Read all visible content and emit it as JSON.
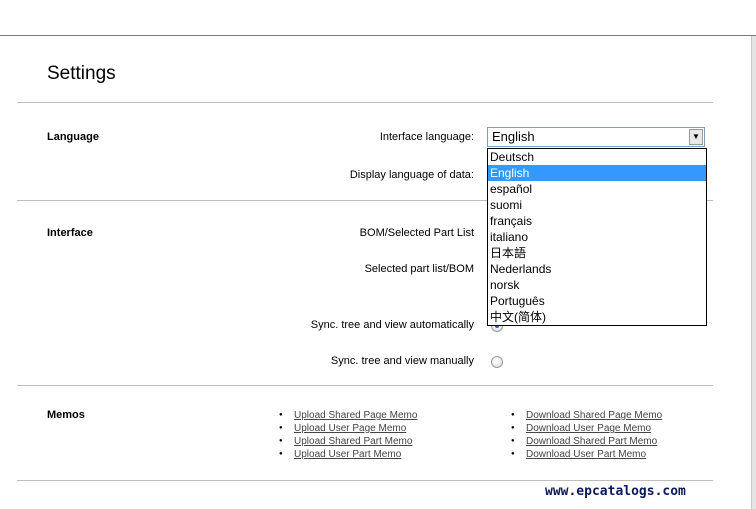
{
  "page": {
    "title": "Settings"
  },
  "language": {
    "heading": "Language",
    "interface_label": "Interface language:",
    "selected": "English",
    "display_label": "Display language of data:",
    "options": [
      "Deutsch",
      "English",
      "español",
      "suomi",
      "français",
      "italiano",
      "日本語",
      "Nederlands",
      "norsk",
      "Português",
      "中文(简体)"
    ],
    "selected_index": 1
  },
  "interface": {
    "heading": "Interface",
    "bom_label": "BOM/Selected Part List",
    "part_label": "Selected part list/BOM",
    "sync_auto_label": "Sync. tree and view automatically",
    "sync_manual_label": "Sync. tree and view manually"
  },
  "memos": {
    "heading": "Memos",
    "upload": [
      "Upload Shared Page Memo",
      "Upload User Page Memo",
      "Upload Shared Part Memo",
      "Upload User Part Memo"
    ],
    "download": [
      "Download Shared Page Memo",
      "Download User Page Memo",
      "Download Shared Part Memo",
      "Download User Part Memo"
    ]
  },
  "watermark": "www.epcatalogs.com",
  "colors": {
    "highlight": "#3399ff",
    "link": "#444444",
    "divider": "#bdbdbd"
  }
}
